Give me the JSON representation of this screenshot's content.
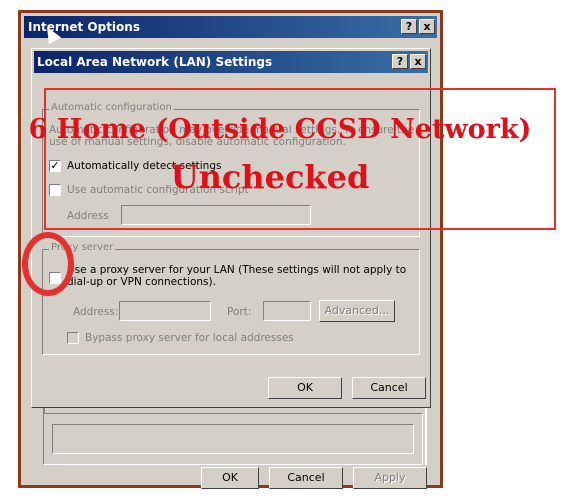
{
  "internet_options": {
    "title": "Internet Options",
    "help_glyph": "?",
    "close_glyph": "x",
    "buttons": {
      "ok": "OK",
      "cancel": "Cancel",
      "apply": "Apply"
    }
  },
  "lan_dialog": {
    "title": "Local Area Network (LAN) Settings",
    "help_glyph": "?",
    "close_glyph": "x",
    "auto_config": {
      "legend": "Automatic configuration",
      "description_line1": "Automatic configuration may override manual settings.  To ensure the",
      "description_line2": "use of manual settings, disable automatic configuration.",
      "auto_detect_label": "Automatically detect settings",
      "auto_detect_checked": true,
      "use_script_label": "Use automatic configuration script",
      "use_script_checked": false,
      "address_label": "Address"
    },
    "proxy": {
      "legend": "Proxy server",
      "use_proxy_line1": "Use a proxy server for your LAN (These settings will not apply to",
      "use_proxy_line2": "dial-up or VPN connections).",
      "use_proxy_checked": false,
      "address_label": "Address:",
      "port_label": "Port:",
      "advanced_button": "Advanced...",
      "bypass_label": "Bypass proxy server for local addresses",
      "bypass_checked": false
    },
    "buttons": {
      "ok": "OK",
      "cancel": "Cancel"
    }
  },
  "annotation": {
    "line1": "6  Home (Outside CCSD Network)",
    "line2": "Unchecked",
    "color": "#e0101a"
  }
}
